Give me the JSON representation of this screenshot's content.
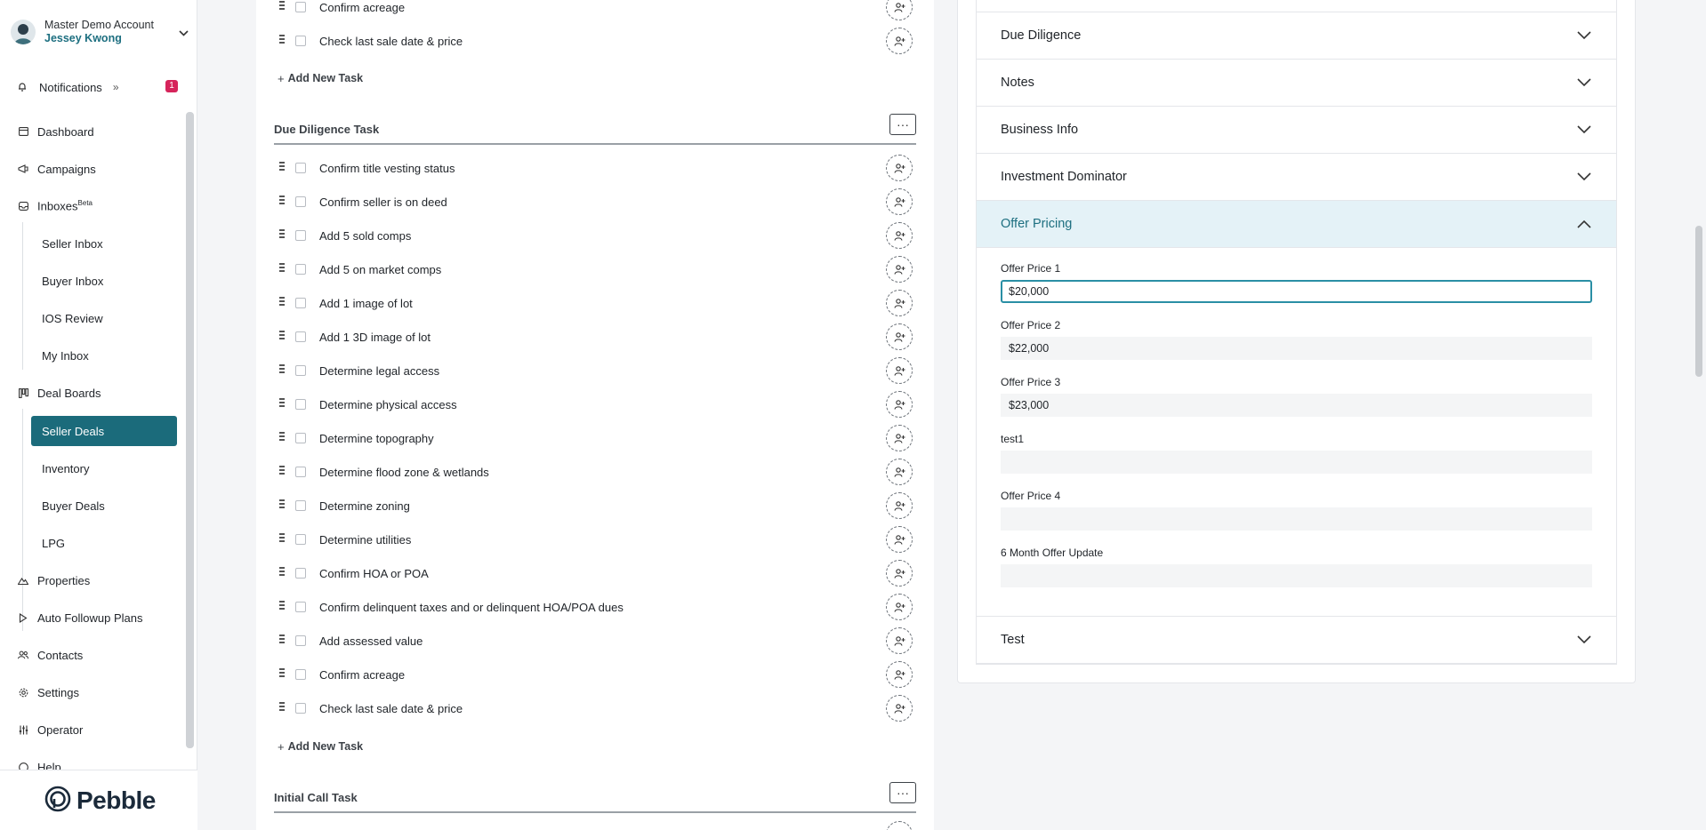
{
  "account": {
    "name": "Master Demo Account",
    "user": "Jessey Kwong"
  },
  "notifications": {
    "label": "Notifications",
    "count": "1"
  },
  "nav": {
    "dashboard": "Dashboard",
    "campaigns": "Campaigns",
    "inboxes": "Inboxes",
    "inboxes_tag": "Beta",
    "seller_inbox": "Seller Inbox",
    "buyer_inbox": "Buyer Inbox",
    "ios_review": "IOS Review",
    "my_inbox": "My Inbox",
    "deal_boards": "Deal Boards",
    "seller_deals": "Seller Deals",
    "inventory": "Inventory",
    "buyer_deals": "Buyer Deals",
    "lpg": "LPG",
    "properties": "Properties",
    "auto_followup": "Auto Followup Plans",
    "contacts": "Contacts",
    "settings": "Settings",
    "operator": "Operator",
    "help": "Help"
  },
  "brand": {
    "logo_text": "Pebble"
  },
  "tasks": {
    "top_rows": [
      "Confirm acreage",
      "Check last sale date & price"
    ],
    "add_new_task": "Add New Task",
    "due_diligence": {
      "title": "Due Diligence Task",
      "rows": [
        "Confirm title vesting status",
        "Confirm seller is on deed",
        "Add 5 sold comps",
        "Add 5 on market comps",
        "Add 1 image of lot",
        "Add 1 3D image of lot",
        "Determine legal access",
        "Determine physical access",
        "Determine topography",
        "Determine flood zone & wetlands",
        "Determine zoning",
        "Determine utilities",
        "Confirm HOA or POA",
        "Confirm delinquent taxes and or delinquent HOA/POA dues",
        "Add assessed value",
        "Confirm acreage",
        "Check last sale date & price"
      ]
    },
    "initial_call": {
      "title": "Initial Call Task"
    }
  },
  "details": {
    "sections": {
      "due_diligence": "Due Diligence",
      "notes": "Notes",
      "business_info": "Business Info",
      "investment_dominator": "Investment Dominator",
      "offer_pricing": "Offer Pricing",
      "test": "Test"
    },
    "offer_fields": {
      "offer_price_1_label": "Offer Price 1",
      "offer_price_1_value": "$20,000",
      "offer_price_2_label": "Offer Price 2",
      "offer_price_2_value": "$22,000",
      "offer_price_3_label": "Offer Price 3",
      "offer_price_3_value": "$23,000",
      "test1_label": "test1",
      "test1_value": "",
      "offer_price_4_label": "Offer Price 4",
      "offer_price_4_value": "",
      "six_month_label": "6 Month Offer Update",
      "six_month_value": ""
    }
  },
  "colors": {
    "accent": "#1b6b7b",
    "badge": "#d6245b",
    "section_open_bg": "#e4f2f7"
  }
}
